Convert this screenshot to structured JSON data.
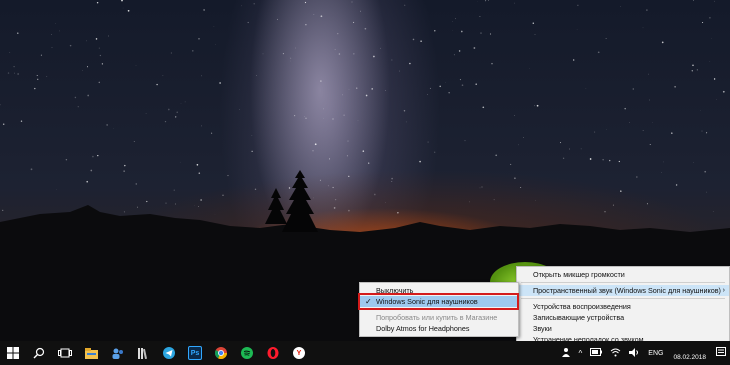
{
  "main_menu": {
    "items": [
      {
        "label": "Открыть микшер громкости"
      },
      {
        "label": "Пространственный звук (Windows Sonic для наушников)",
        "submenu_arrow": "›"
      },
      {
        "label": "Устройства воспроизведения"
      },
      {
        "label": "Записывающие устройства"
      },
      {
        "label": "Звуки"
      },
      {
        "label": "Устранение неполадок со звуком"
      }
    ]
  },
  "spatial_submenu": {
    "off_label": "Выключить",
    "sonic_label": "Windows Sonic для наушников",
    "check_mark": "✓",
    "store_label": "Попробовать или купить в Магазине",
    "dolby_label": "Dolby Atmos for Headphones"
  },
  "taskbar": {
    "pinned_apps": [
      {
        "name": "start-icon"
      },
      {
        "name": "search-icon"
      },
      {
        "name": "task-view-icon"
      },
      {
        "name": "file-explorer-icon"
      },
      {
        "name": "people-icon"
      },
      {
        "name": "library-icon"
      },
      {
        "name": "telegram-icon"
      },
      {
        "name": "photoshop-icon",
        "label": "Ps"
      },
      {
        "name": "chrome-icon"
      },
      {
        "name": "spotify-icon"
      },
      {
        "name": "opera-icon"
      },
      {
        "name": "yandex-browser-icon",
        "label": "Y"
      }
    ],
    "tray": {
      "language": "ENG",
      "date": "08.02.2018"
    }
  },
  "colors": {
    "highlight_outline": "#d41b1b",
    "menu_selected": "#9ec9ee",
    "menu_hover": "#cce4f7",
    "taskbar": "#101010"
  }
}
